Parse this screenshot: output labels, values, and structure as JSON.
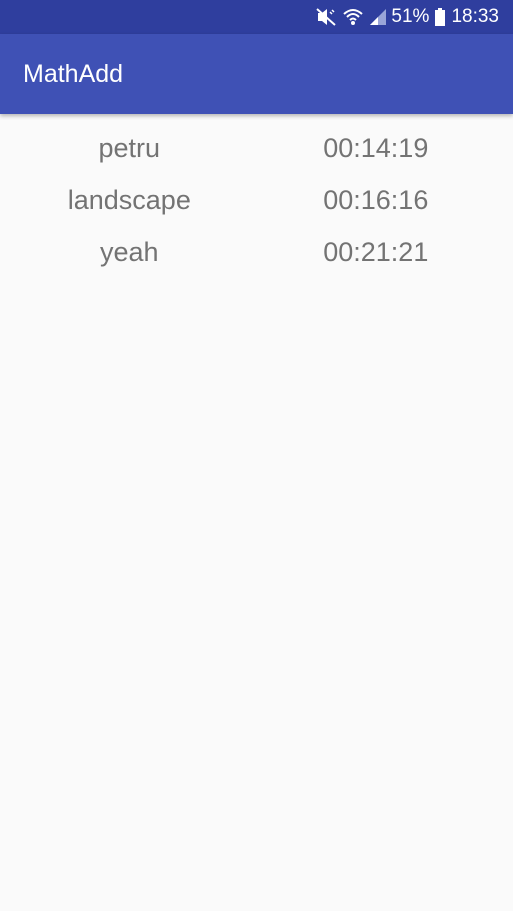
{
  "status_bar": {
    "icons": [
      "mute-vibrate-icon",
      "wifi-icon",
      "signal-icon",
      "battery-icon"
    ],
    "battery_percent": "51%",
    "time": "18:33"
  },
  "app_bar": {
    "title": "MathAdd"
  },
  "scores": [
    {
      "name": "petru",
      "time": "00:14:19"
    },
    {
      "name": "landscape",
      "time": "00:16:16"
    },
    {
      "name": "yeah",
      "time": "00:21:21"
    }
  ],
  "colors": {
    "status_bar": "#2f3e9e",
    "app_bar": "#3f51b5",
    "background": "#fafafa",
    "text": "#737373"
  }
}
